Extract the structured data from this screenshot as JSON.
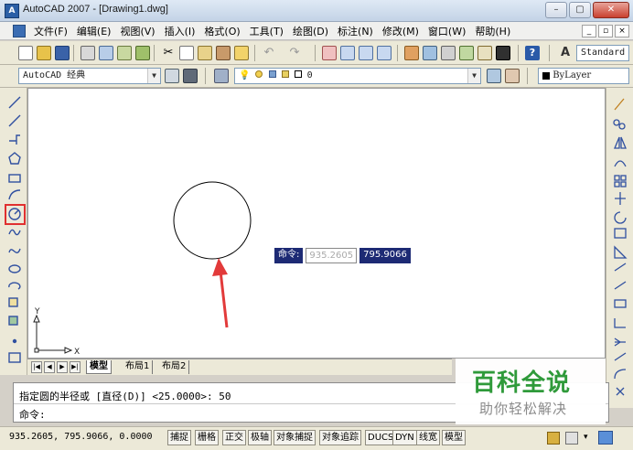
{
  "window": {
    "title": "AutoCAD 2007 - [Drawing1.dwg]",
    "app_icon_text": "A"
  },
  "menu": {
    "items": [
      "文件(F)",
      "编辑(E)",
      "视图(V)",
      "插入(I)",
      "格式(O)",
      "工具(T)",
      "绘图(D)",
      "标注(N)",
      "修改(M)",
      "窗口(W)",
      "帮助(H)"
    ]
  },
  "toolbar": {
    "text_style": "Standard",
    "workspace": "AutoCAD 经典",
    "layer": "0",
    "color": "ByLayer"
  },
  "dynamic_input": {
    "label": "命令:",
    "x_value": "935.2605",
    "y_value": "795.9066"
  },
  "ucs": {
    "x_label": "X",
    "y_label": "Y"
  },
  "layout_tabs": [
    "模型",
    "布局1",
    "布局2"
  ],
  "command_window": {
    "history_line": "指定圆的半径或 [直径(D)] <25.0000>: 50",
    "prompt": "命令:"
  },
  "status_bar": {
    "coordinates": "935.2605, 795.9066, 0.0000",
    "toggles": [
      "捕捉",
      "栅格",
      "正交",
      "极轴",
      "对象捕捉",
      "对象追踪",
      "DUCS",
      "DYN",
      "线宽",
      "模型"
    ]
  },
  "watermark": {
    "title": "百科全说",
    "subtitle": "助你轻松解决"
  },
  "colors": {
    "highlight_box": "#e03030",
    "arrow": "#e23a3a",
    "dynamic_input_bg": "#1d2a74"
  }
}
